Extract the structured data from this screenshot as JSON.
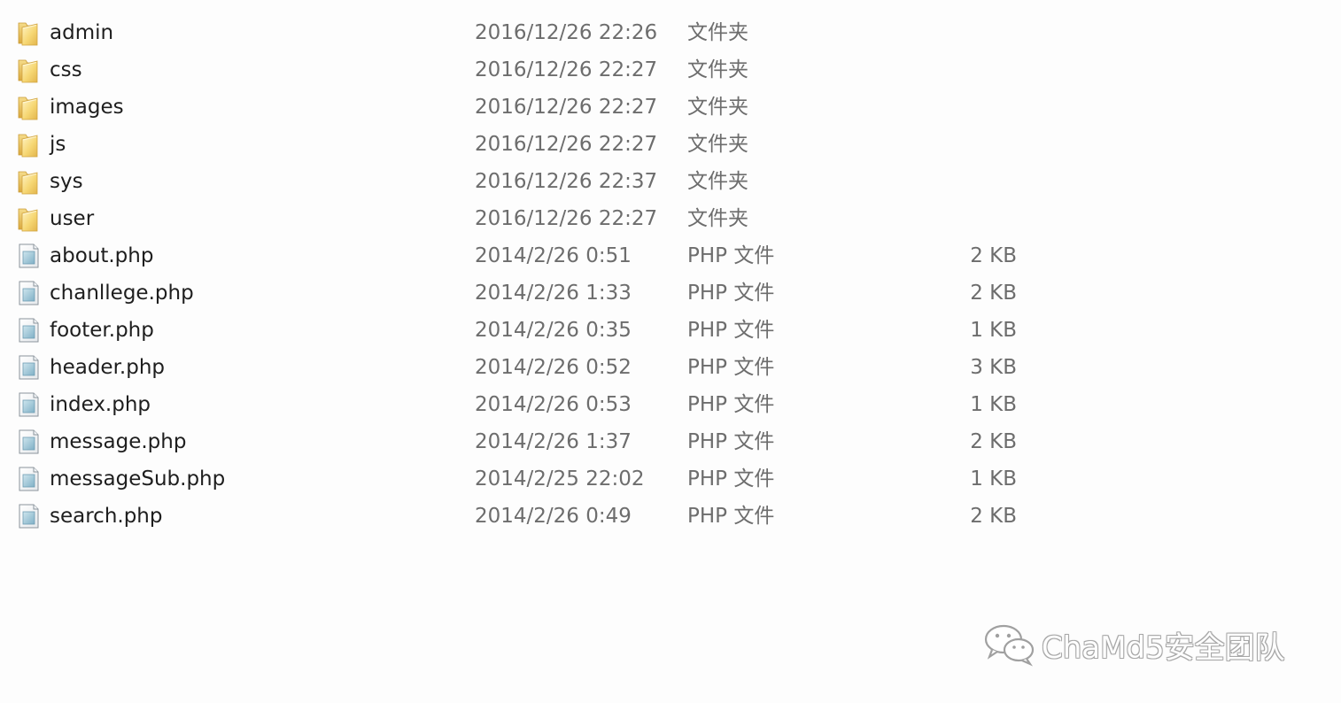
{
  "files": [
    {
      "name": "admin",
      "date": "2016/12/26 22:26",
      "type": "文件夹",
      "size": "",
      "icon": "folder-icon"
    },
    {
      "name": "css",
      "date": "2016/12/26 22:27",
      "type": "文件夹",
      "size": "",
      "icon": "folder-icon"
    },
    {
      "name": "images",
      "date": "2016/12/26 22:27",
      "type": "文件夹",
      "size": "",
      "icon": "folder-icon"
    },
    {
      "name": "js",
      "date": "2016/12/26 22:27",
      "type": "文件夹",
      "size": "",
      "icon": "folder-icon"
    },
    {
      "name": "sys",
      "date": "2016/12/26 22:37",
      "type": "文件夹",
      "size": "",
      "icon": "folder-icon"
    },
    {
      "name": "user",
      "date": "2016/12/26 22:27",
      "type": "文件夹",
      "size": "",
      "icon": "folder-icon"
    },
    {
      "name": "about.php",
      "date": "2014/2/26 0:51",
      "type": "PHP 文件",
      "size": "2 KB",
      "icon": "php-file-icon"
    },
    {
      "name": "chanllege.php",
      "date": "2014/2/26 1:33",
      "type": "PHP 文件",
      "size": "2 KB",
      "icon": "php-file-icon"
    },
    {
      "name": "footer.php",
      "date": "2014/2/26 0:35",
      "type": "PHP 文件",
      "size": "1 KB",
      "icon": "php-file-icon"
    },
    {
      "name": "header.php",
      "date": "2014/2/26 0:52",
      "type": "PHP 文件",
      "size": "3 KB",
      "icon": "php-file-icon"
    },
    {
      "name": "index.php",
      "date": "2014/2/26 0:53",
      "type": "PHP 文件",
      "size": "1 KB",
      "icon": "php-file-icon"
    },
    {
      "name": "message.php",
      "date": "2014/2/26 1:37",
      "type": "PHP 文件",
      "size": "2 KB",
      "icon": "php-file-icon"
    },
    {
      "name": "messageSub.php",
      "date": "2014/2/25 22:02",
      "type": "PHP 文件",
      "size": "1 KB",
      "icon": "php-file-icon"
    },
    {
      "name": "search.php",
      "date": "2014/2/26 0:49",
      "type": "PHP 文件",
      "size": "2 KB",
      "icon": "php-file-icon"
    }
  ],
  "watermark": {
    "text": "ChaMd5安全团队",
    "icon": "wechat-icon"
  }
}
